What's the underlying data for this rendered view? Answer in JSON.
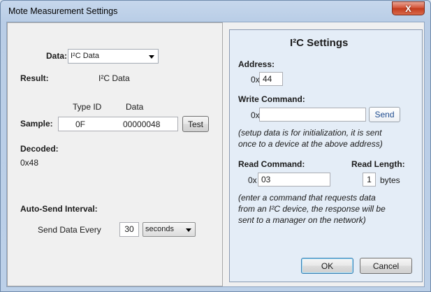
{
  "window": {
    "title": "Mote Measurement Settings",
    "close_glyph": "X"
  },
  "left": {
    "data_label": "Data:",
    "data_select": "I²C Data",
    "result_label": "Result:",
    "result_value": "I²C Data",
    "col_type_id": "Type ID",
    "col_data": "Data",
    "sample_label": "Sample:",
    "type_id_value": "0F",
    "data_value": "00000048",
    "test_button": "Test",
    "decoded_label": "Decoded:",
    "decoded_value": "0x48",
    "auto_send_label": "Auto-Send Interval:",
    "send_every_label": "Send Data Every",
    "interval_value": "30",
    "interval_unit": "seconds"
  },
  "right": {
    "title": "I²C Settings",
    "address_label": "Address:",
    "address_prefix": "0x",
    "address_value": "44",
    "write_label": "Write Command:",
    "write_prefix": "0x",
    "write_value": "",
    "send_button": "Send",
    "write_note_1": "(setup data is for initialization, it is sent",
    "write_note_2": "once to a device at the above address)",
    "read_label": "Read Command:",
    "read_length_label": "Read Length:",
    "read_prefix": "0x",
    "read_value": "03",
    "read_length_value": "1",
    "read_length_unit": "bytes",
    "read_note_1": "(enter a command that requests data",
    "read_note_2": "from an I²C device, the response will be",
    "read_note_3": "sent to a manager on the network)",
    "ok_button": "OK",
    "cancel_button": "Cancel"
  }
}
